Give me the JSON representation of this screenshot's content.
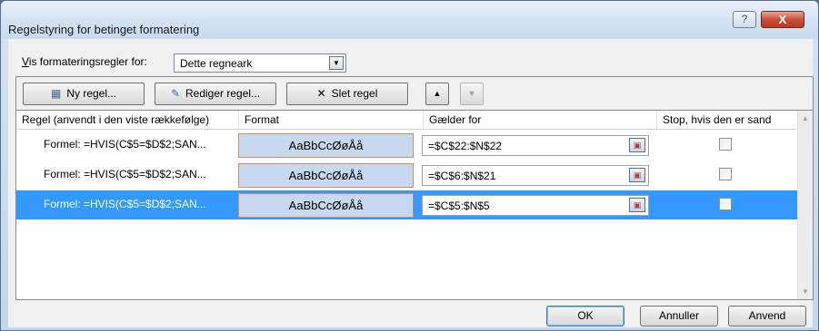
{
  "window": {
    "title": "Regelstyring for betinget formatering",
    "help_glyph": "?",
    "close_glyph": "X"
  },
  "filter": {
    "label_prefix": "V",
    "label_rest": "is formateringsregler for:",
    "selected": "Dette regneark",
    "arrow_glyph": "▼"
  },
  "toolbar": {
    "new_rule": "Ny regel...",
    "edit_rule": "Rediger regel...",
    "delete_rule": "Slet regel",
    "new_icon": "▦",
    "edit_icon": "✎",
    "delete_icon": "✕",
    "up_glyph": "▲",
    "down_glyph": "▼"
  },
  "grid": {
    "columns": [
      "Regel (anvendt i den viste rækkefølge)",
      "Format",
      "Gælder for",
      "Stop, hvis den er sand"
    ],
    "rows": [
      {
        "rule": "Formel: =HVIS(C$5=$D$2;SAN...",
        "preview": "AaBbCcØøÅå",
        "applies_to": "=$C$22:$N$22"
      },
      {
        "rule": "Formel: =HVIS(C$5=$D$2;SAN...",
        "preview": "AaBbCcØøÅå",
        "applies_to": "=$C$6:$N$21"
      },
      {
        "rule": "Formel: =HVIS(C$5=$D$2;SAN...",
        "preview": "AaBbCcØøÅå",
        "applies_to": "=$C$5:$N$5"
      }
    ],
    "selected_row": 2,
    "collapse_glyph": "▣",
    "scroll_up": "▲",
    "scroll_down": "▼"
  },
  "footer": {
    "ok": "OK",
    "cancel": "Annuller",
    "apply": "Anvend"
  },
  "colors": {
    "selection": "#3399ff",
    "preview_fill": "#c6d9f1",
    "close_red": "#c8503a"
  }
}
